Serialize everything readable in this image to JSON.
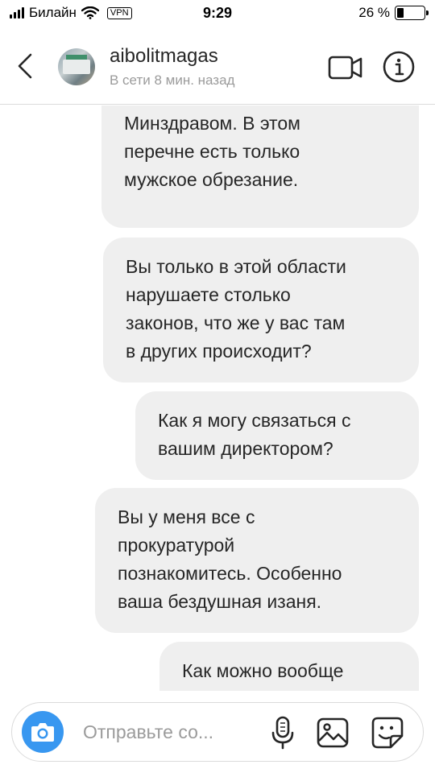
{
  "status_bar": {
    "carrier": "Билайн",
    "vpn": "VPN",
    "time": "9:29",
    "battery_percent": "26 %",
    "battery_level": 0.26
  },
  "header": {
    "username": "aibolitmagas",
    "presence": "В сети 8 мин. назад",
    "icons": {
      "back": "chevron-left-icon",
      "video": "video-camera-icon",
      "info": "info-icon"
    }
  },
  "messages": [
    {
      "sender": "other",
      "text": "услуг, устанавливаемых\nМинздравом. В этом\nперечне есть только\nмужское обрезание."
    },
    {
      "sender": "other",
      "text": "Вы только в этой области\nнарушаете столько\nзаконов, что же у вас там\nв других происходит?"
    },
    {
      "sender": "other",
      "text": "Как я могу связаться с\nвашим директором?"
    },
    {
      "sender": "other",
      "text": "Вы у меня все с\nпрокуратурой\nпознакомитесь. Особенно\nваша бездушная изаня."
    },
    {
      "sender": "other",
      "text": "Как можно вообще"
    }
  ],
  "composer": {
    "placeholder": "Отправьте со...",
    "icons": {
      "camera": "camera-icon",
      "mic": "microphone-icon",
      "gallery": "image-gallery-icon",
      "sticker": "sticker-icon"
    },
    "camera_color": "#3897f0"
  },
  "colors": {
    "bubble": "#efefef",
    "secondary_text": "#9b9b9b",
    "divider": "#dbdbdb"
  }
}
